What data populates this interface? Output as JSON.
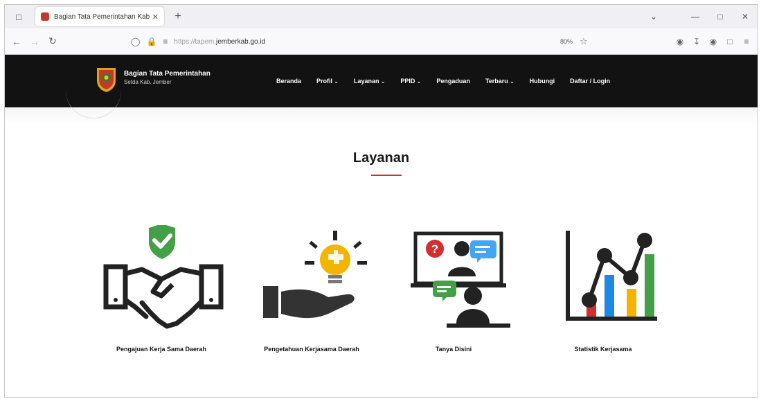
{
  "browser": {
    "tab_title": "Bagian Tata Pemerintahan Kab.",
    "url_prefix": "https://tapem.",
    "url_domain": "jemberkab.go.id",
    "zoom": "80%"
  },
  "site": {
    "brand_name": "Bagian Tata Pemerintahan",
    "brand_sub": "Setda Kab. Jember",
    "menu": [
      {
        "label": "Beranda"
      },
      {
        "label": "Profil"
      },
      {
        "label": "Layanan"
      },
      {
        "label": "PPID"
      },
      {
        "label": "Pengaduan"
      },
      {
        "label": "Terbaru"
      },
      {
        "label": "Hubungi"
      },
      {
        "label": "Daftar / Login"
      }
    ]
  },
  "section": {
    "title": "Layanan",
    "accent_color": "#d32f2f",
    "services": [
      {
        "label": "Pengajuan Kerja Sama Daerah",
        "icon": "handshake-shield-icon"
      },
      {
        "label": "Pengetahuan Kerjasama Daerah",
        "icon": "lightbulb-hand-icon"
      },
      {
        "label": "Tanya Disini",
        "icon": "chat-people-icon"
      },
      {
        "label": "Statistik Kerjasama",
        "icon": "statistics-chart-icon"
      }
    ]
  }
}
